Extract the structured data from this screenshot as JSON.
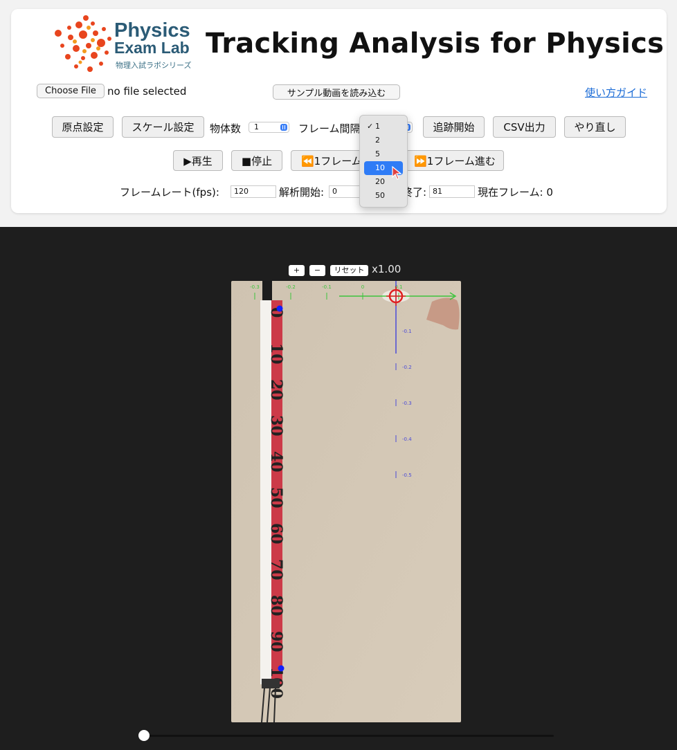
{
  "app": {
    "title": "Tracking Analysis for Physics",
    "logo": {
      "line1": "Physics",
      "line2": "Exam Lab",
      "tagline": "物理入試ラボシリーズ"
    }
  },
  "file": {
    "choose_label": "Choose File",
    "status": "no file selected",
    "sample_button": "サンプル動画を読み込む",
    "guide_link": "使い方ガイド"
  },
  "toolbar": {
    "origin_button": "原点設定",
    "scale_button": "スケール設定",
    "objects_label": "物体数",
    "objects_value": "1",
    "frame_interval_label": "フレーム間隔",
    "track_button": "追跡開始",
    "csv_button": "CSV出力",
    "redo_button": "やり直し"
  },
  "playback": {
    "play_button": "▶再生",
    "stop_button": "■停止",
    "back_button": "⏪1フレーム戻る",
    "forward_button": "⏩1フレーム進む"
  },
  "params": {
    "fps_label": "フレームレート(fps):",
    "fps_value": "120",
    "start_label": "解析開始:",
    "start_value": "0",
    "end_label": "終了:",
    "end_value": "81",
    "current_label": "現在フレーム: 0"
  },
  "dropdown": {
    "options": [
      "1",
      "2",
      "5",
      "10",
      "20",
      "50"
    ],
    "checked": "1",
    "highlighted": "10"
  },
  "viewer": {
    "zoom_in": "+",
    "zoom_out": "−",
    "reset": "リセット",
    "zoom_level": "x1.00",
    "x_ticks": [
      "-0.3",
      "-0.2",
      "-0.1",
      "0",
      "0.1"
    ],
    "y_ticks": [
      "-0.1",
      "-0.2",
      "-0.3",
      "-0.4",
      "-0.5"
    ],
    "ruler_marks": [
      "0",
      "10",
      "20",
      "30",
      "40",
      "50",
      "60",
      "70",
      "80",
      "90",
      "100"
    ],
    "slider_position": 0
  },
  "colors": {
    "accent": "#2f7cf6",
    "link": "#1a6bd6",
    "axis_x": "#3cc43c",
    "axis_y": "#4a4ad8",
    "target": "#e02020",
    "marker": "#1020ff"
  }
}
